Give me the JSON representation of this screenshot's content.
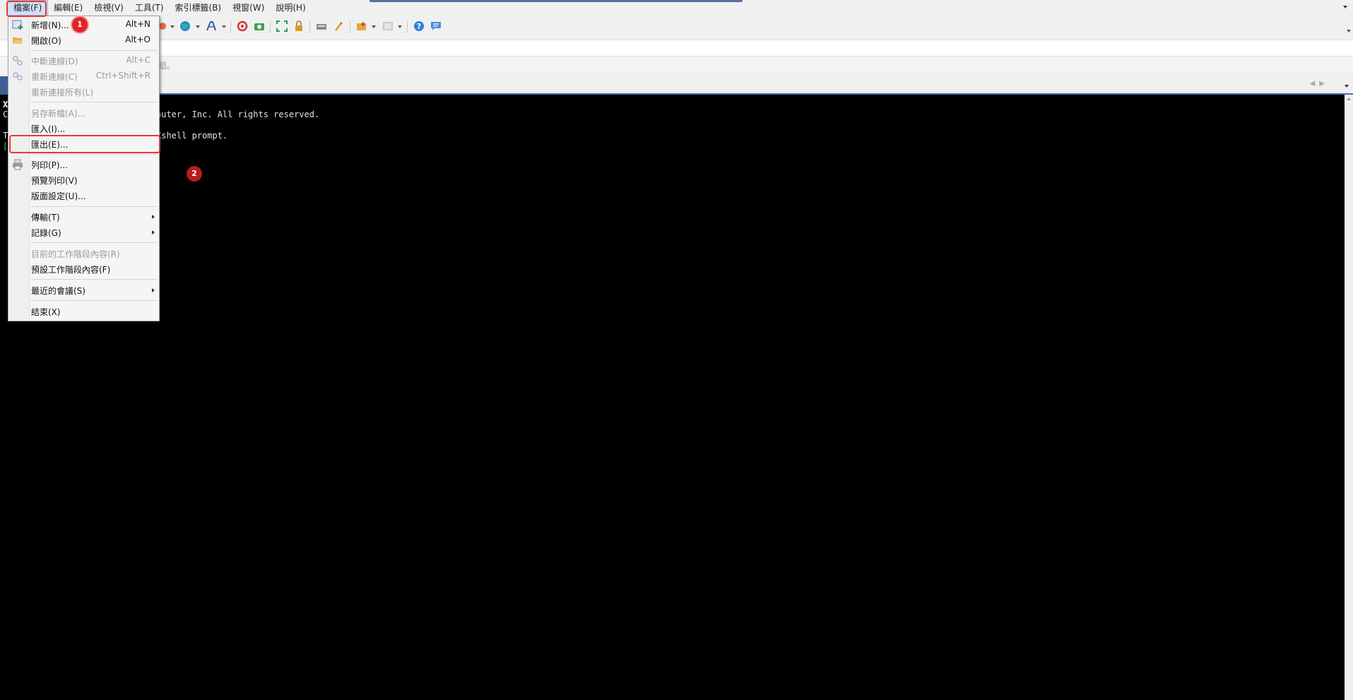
{
  "menubar": {
    "items": [
      "檔案(F)",
      "編輯(E)",
      "檢視(V)",
      "工具(T)",
      "索引標籤(B)",
      "視窗(W)",
      "說明(H)"
    ]
  },
  "hint": {
    "fragment": "組。"
  },
  "terminal": {
    "line_bold": "X",
    "line_c": "C",
    "line_rights": "puter, Inc. All rights reserved.",
    "line_t": "T",
    "line_prompt": "Xshell prompt.",
    "cursor": "["
  },
  "file_menu": {
    "new": {
      "label": "新增(N)...",
      "shortcut": "Alt+N"
    },
    "open": {
      "label": "開啟(O)",
      "shortcut": "Alt+O"
    },
    "disconnect": {
      "label": "中斷連線(D)",
      "shortcut": "Alt+C"
    },
    "reconnect": {
      "label": "重新連線(C)",
      "shortcut": "Ctrl+Shift+R"
    },
    "reconnect_all": {
      "label": "重新連接所有(L)"
    },
    "save_as": {
      "label": "另存新檔(A)..."
    },
    "import": {
      "label": "匯入(I)..."
    },
    "export": {
      "label": "匯出(E)..."
    },
    "print": {
      "label": "列印(P)..."
    },
    "print_preview": {
      "label": "預覽列印(V)"
    },
    "page_setup": {
      "label": "版面設定(U)..."
    },
    "transfer": {
      "label": "傳輸(T)"
    },
    "log": {
      "label": "記錄(G)"
    },
    "current_session_props": {
      "label": "目前的工作階段內容(R)"
    },
    "default_session_props": {
      "label": "預設工作階段內容(F)"
    },
    "recent_sessions": {
      "label": "最近的會議(S)"
    },
    "exit": {
      "label": "結束(X)"
    }
  },
  "annotations": {
    "badge_1": "1",
    "badge_2": "2"
  },
  "colors": {
    "highlight": "#e53935",
    "badge": "#e02424",
    "terminal_bg": "#000000",
    "tab_accent": "#4a6ea8"
  }
}
